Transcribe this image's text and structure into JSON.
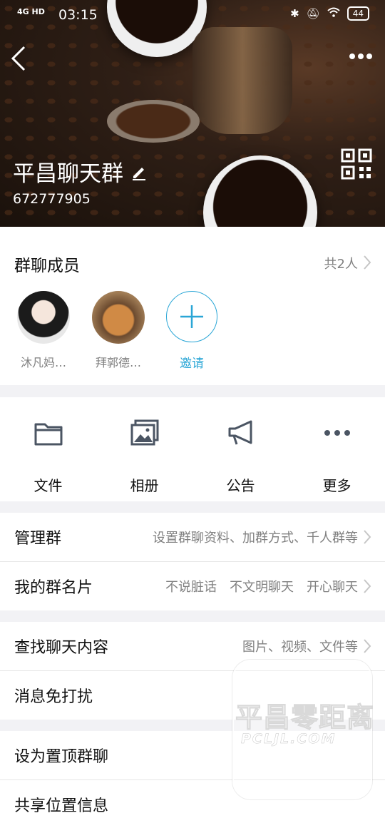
{
  "status_bar": {
    "network": "4G HD",
    "time": "03:15",
    "battery": "44"
  },
  "header": {
    "group_name": "平昌聊天群",
    "group_id": "672777905"
  },
  "members": {
    "title": "群聊成员",
    "count": "共2人",
    "list": [
      {
        "name": "沐凡妈…"
      },
      {
        "name": "拜郭德…"
      }
    ],
    "invite_label": "邀请"
  },
  "tools": [
    {
      "label": "文件"
    },
    {
      "label": "相册"
    },
    {
      "label": "公告"
    },
    {
      "label": "更多"
    }
  ],
  "settings": {
    "manage": {
      "label": "管理群",
      "value": "设置群聊资料、加群方式、千人群等"
    },
    "card": {
      "label": "我的群名片",
      "value": "不说脏话　不文明聊天　开心聊天"
    },
    "search": {
      "label": "查找聊天内容",
      "value": "图片、视频、文件等"
    },
    "mute": {
      "label": "消息免打扰"
    },
    "pin": {
      "label": "设为置顶群聊"
    },
    "location": {
      "label": "共享位置信息"
    }
  },
  "watermark": {
    "cn": "平昌零距离",
    "en": "PCLJL.COM"
  },
  "colors": {
    "accent": "#2aa6d6",
    "text": "#111111",
    "secondary": "#808080",
    "background": "#f2f2f5"
  }
}
